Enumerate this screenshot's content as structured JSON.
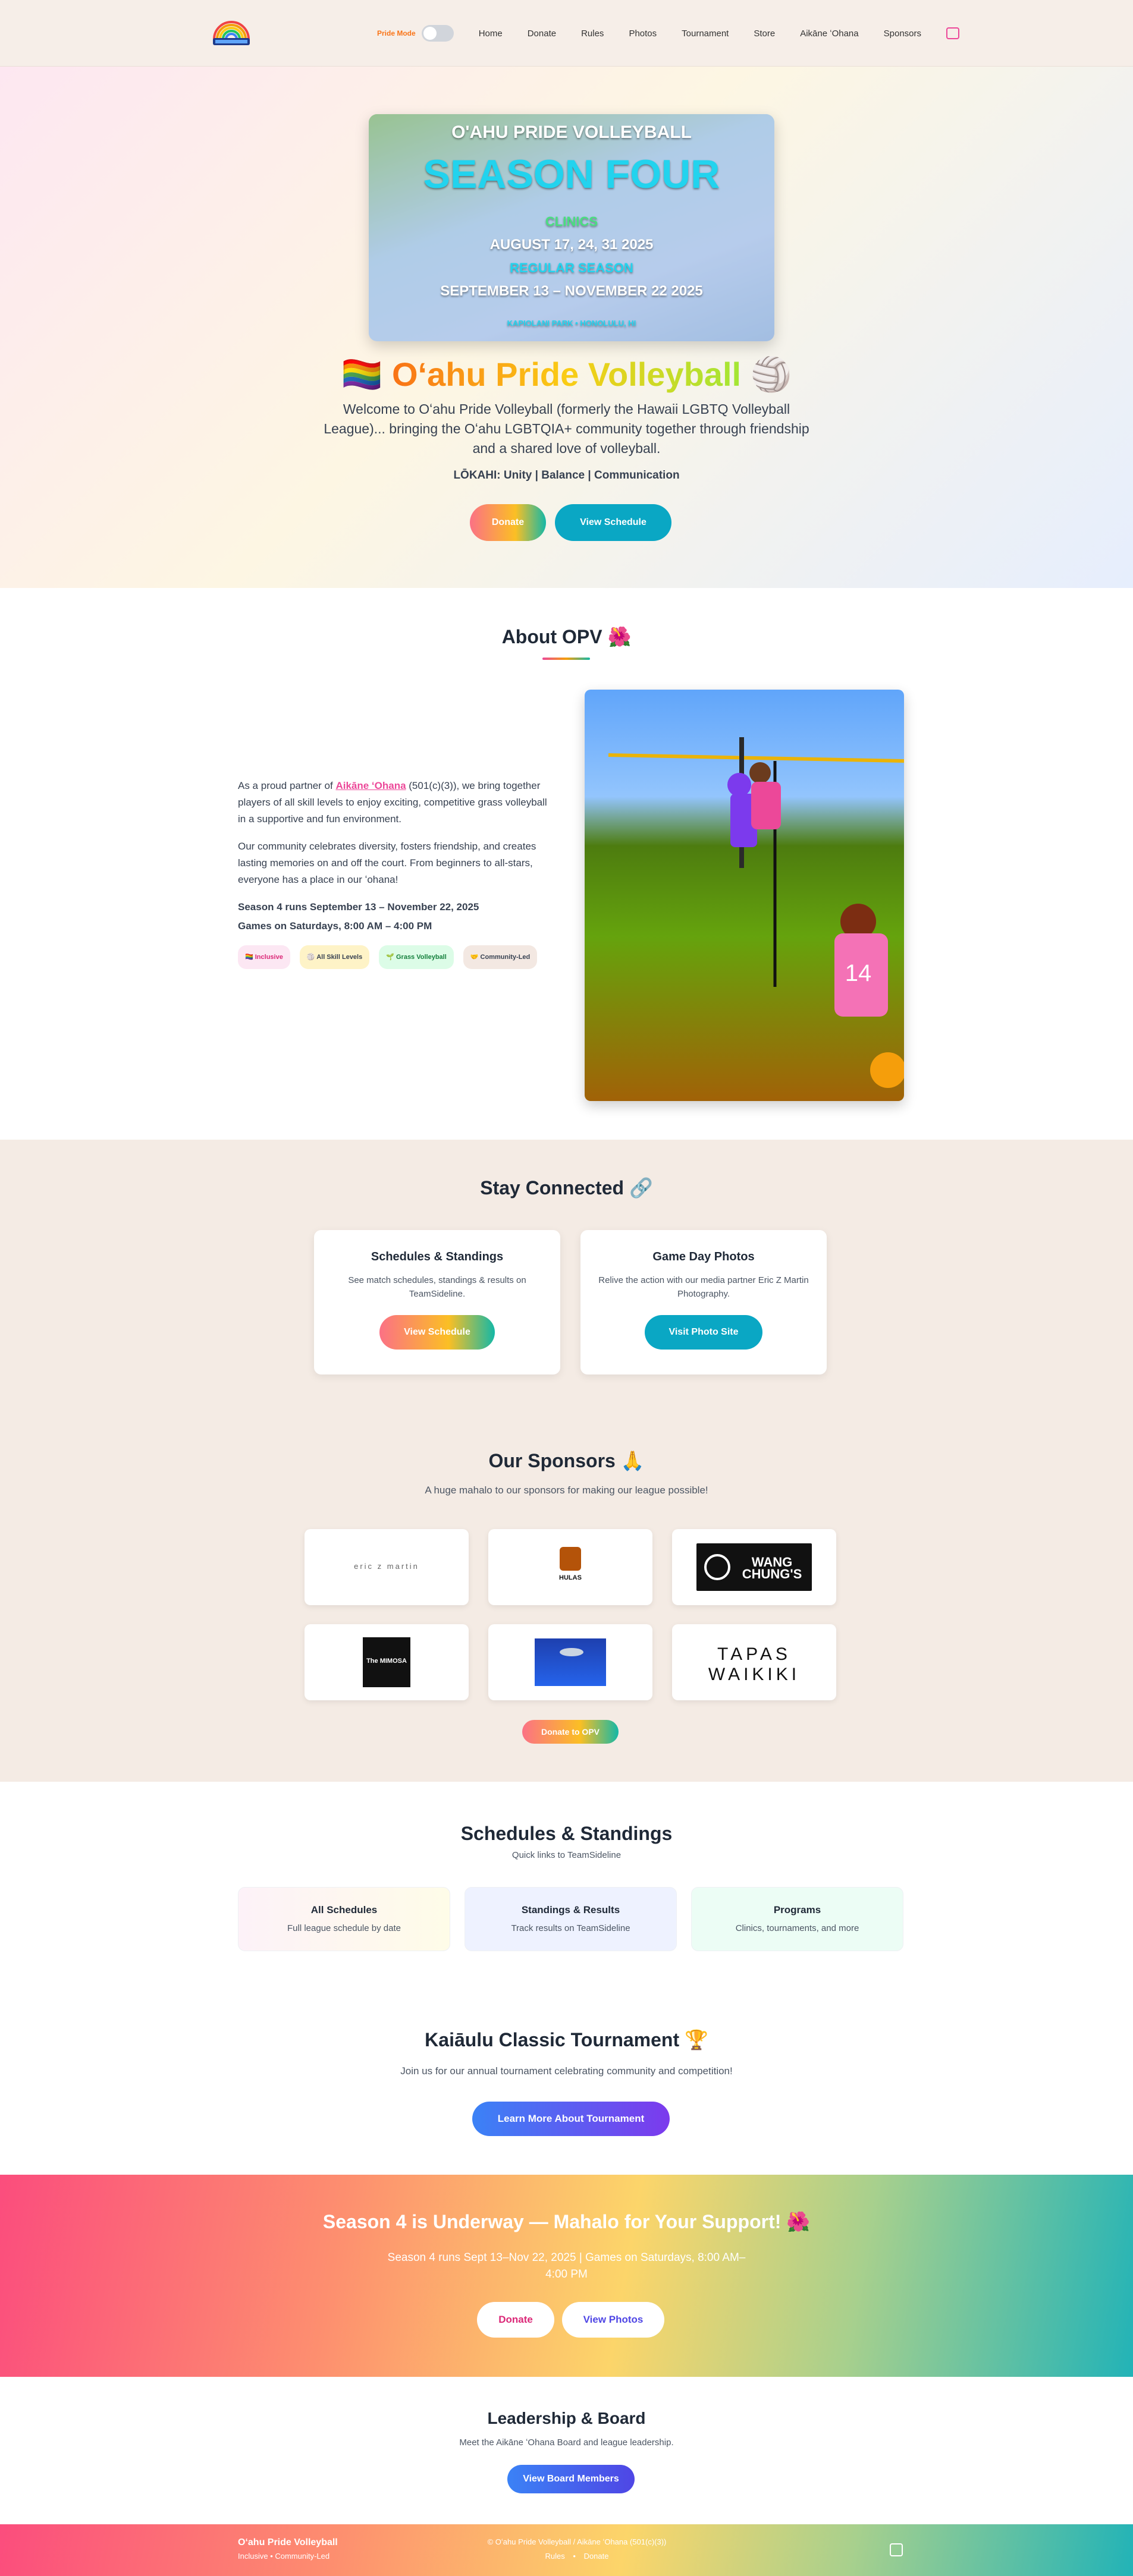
{
  "nav": {
    "pride_mode_label": "Pride Mode",
    "links": [
      "Home",
      "Donate",
      "Rules",
      "Photos",
      "Tournament",
      "Store",
      "Aikāne ʻOhana",
      "Sponsors"
    ]
  },
  "hero": {
    "poster": {
      "line1": "O'AHU PRIDE VOLLEYBALL",
      "line2": "SEASON FOUR",
      "line3": "CLINICS",
      "line4": "AUGUST 17, 24, 31 2025",
      "line5": "REGULAR SEASON",
      "line6": "SEPTEMBER 13 – NOVEMBER 22 2025",
      "line7": "KAPIOLANI PARK • HONOLULU, HI"
    },
    "title": "Oʻahu Pride Volleyball",
    "flag_emoji": "🏳️‍🌈",
    "ball_emoji": "🏐",
    "subtitle": "Welcome to Oʻahu Pride Volleyball (formerly the Hawaii LGBTQ Volleyball League)... bringing the Oʻahu LGBTQIA+ community together through friendship and a shared love of volleyball.",
    "lokahi": "LŌKAHI: Unity | Balance | Communication",
    "donate_label": "Donate",
    "schedule_label": "View Schedule"
  },
  "about": {
    "title": "About OPV 🌺",
    "p1_before": "As a proud partner of ",
    "p1_link": "Aikāne ʻOhana",
    "p1_after": " (501(c)(3)), we bring together players of all skill levels to enjoy exciting, competitive grass volleyball in a supportive and fun environment.",
    "p2": "Our community celebrates diversity, fosters friendship, and creates lasting memories on and off the court. From beginners to all-stars, everyone has a place in our ʻohana!",
    "season": "Season 4 runs September 13 – November 22, 2025",
    "games": "Games on Saturdays, 8:00 AM – 4:00 PM",
    "badges": [
      "🏳️‍🌈 Inclusive",
      "🏐 All Skill Levels",
      "🌱 Grass Volleyball",
      "🤝 Community-Led"
    ]
  },
  "stay": {
    "title": "Stay Connected 🔗",
    "card1": {
      "title": "Schedules & Standings",
      "text": "See match schedules, standings & results on TeamSideline.",
      "button": "View Schedule"
    },
    "card2": {
      "title": "Game Day Photos",
      "text": "Relive the action with our media partner Eric Z Martin Photography.",
      "button": "Visit Photo Site"
    }
  },
  "sponsors": {
    "title": "Our Sponsors 🙏",
    "subtitle": "A huge mahalo to our sponsors for making our league possible!",
    "logos": [
      "eric z martin",
      "HULAS",
      "WANG CHUNG'S",
      "The MIMOSA",
      "",
      "TAPAS WAIKIKI"
    ],
    "donate_label": "Donate to OPV"
  },
  "schedules": {
    "title": "Schedules & Standings",
    "subtitle": "Quick links to TeamSideline",
    "items": [
      {
        "title": "All Schedules",
        "text": "Full league schedule by date"
      },
      {
        "title": "Standings & Results",
        "text": "Track results on TeamSideline"
      },
      {
        "title": "Programs",
        "text": "Clinics, tournaments, and more"
      }
    ]
  },
  "tournament": {
    "title": "Kaiāulu Classic Tournament 🏆",
    "subtitle": "Join us for our annual tournament celebrating community and competition!",
    "button": "Learn More About Tournament"
  },
  "banner": {
    "title": "Season 4 is Underway — Mahalo for Your Support! 🌺",
    "line1": "Season 4 runs Sept 13–Nov 22, 2025 | Games on Saturdays, 8:00 AM–",
    "line2": "4:00 PM",
    "donate": "Donate",
    "photos": "View Photos"
  },
  "leadership": {
    "title": "Leadership & Board",
    "subtitle": "Meet the Aikāne ʻOhana Board and league leadership.",
    "button": "View Board Members"
  },
  "footer": {
    "brand": "Oʻahu Pride Volleyball",
    "tagline": "Inclusive • Community-Led",
    "copyright": "© Oʻahu Pride Volleyball / Aikāne ʻOhana (501(c)(3))",
    "links": [
      "Rules",
      "Donate"
    ]
  },
  "colors": {
    "accent_pink": "#ec4899",
    "accent_teal": "#0aa7c4",
    "accent_orange": "#f59e0b",
    "nav_bg": "#f6eee8"
  }
}
